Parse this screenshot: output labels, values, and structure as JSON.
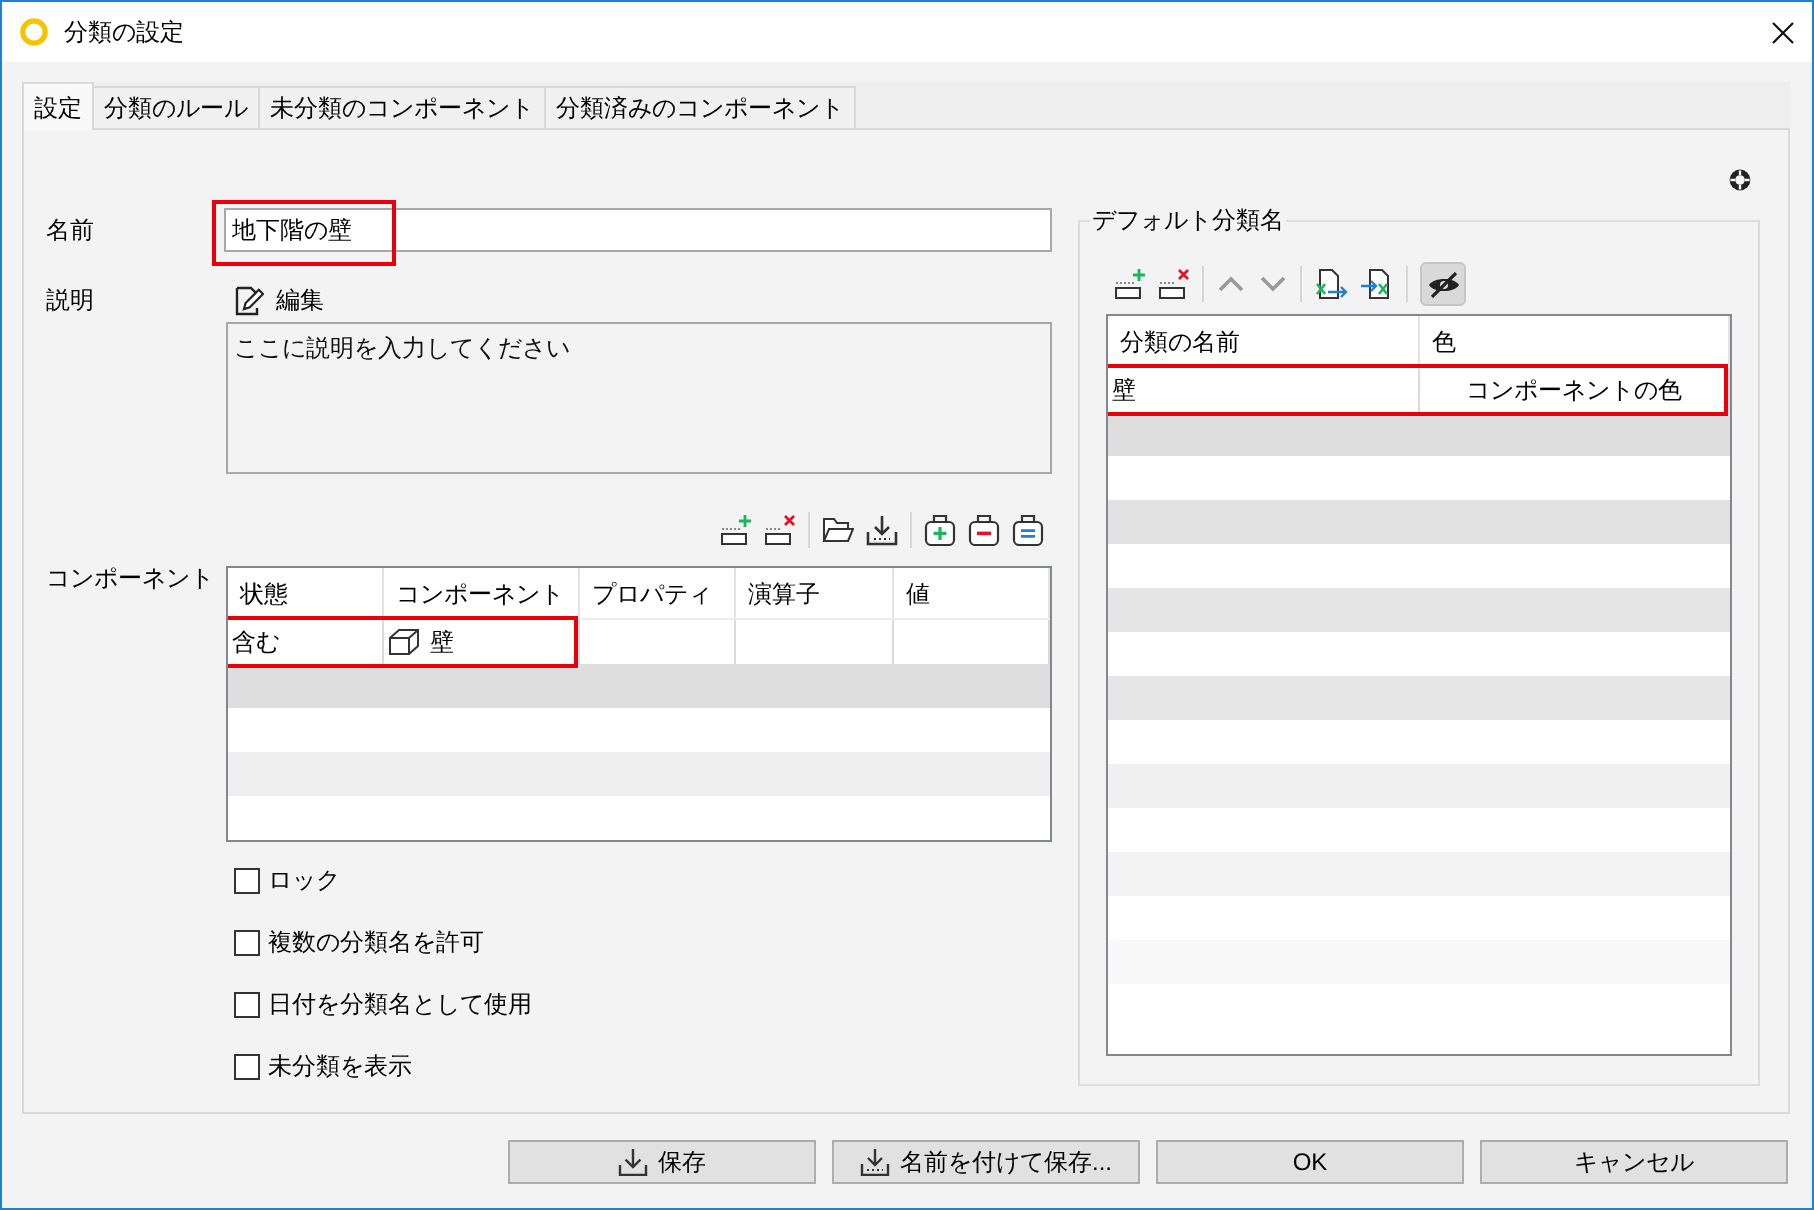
{
  "window": {
    "title": "分類の設定"
  },
  "tabs": [
    {
      "label": "設定",
      "selected": true
    },
    {
      "label": "分類のルール",
      "selected": false
    },
    {
      "label": "未分類のコンポーネント",
      "selected": false
    },
    {
      "label": "分類済みのコンポーネント",
      "selected": false
    }
  ],
  "name_field": {
    "label": "名前",
    "value": "地下階の壁",
    "highlighted": true
  },
  "description": {
    "label": "説明",
    "edit_button": "編集",
    "placeholder": "ここに説明を入力してください"
  },
  "components": {
    "label": "コンポーネント",
    "columns": [
      "状態",
      "コンポーネント",
      "プロパティ",
      "演算子",
      "値"
    ],
    "rows": [
      {
        "cells": [
          "含む",
          "壁"
        ],
        "highlighted": true
      }
    ]
  },
  "options": [
    {
      "label": "ロック",
      "checked": false
    },
    {
      "label": "複数の分類名を許可",
      "checked": false
    },
    {
      "label": "日付を分類名として使用",
      "checked": false
    },
    {
      "label": "未分類を表示",
      "checked": false
    }
  ],
  "default_names": {
    "title": "デフォルト分類名",
    "visibility_toggle": {
      "pressed": true
    },
    "columns": [
      "分類の名前",
      "色"
    ],
    "rows": [
      {
        "cells": [
          "壁",
          "コンポーネントの色"
        ],
        "highlighted": true
      }
    ]
  },
  "buttons": [
    {
      "kind": "save",
      "label": "保存"
    },
    {
      "kind": "save_as",
      "label": "名前を付けて保存..."
    },
    {
      "kind": "ok",
      "label": "OK"
    },
    {
      "kind": "cancel",
      "label": "キャンセル"
    }
  ]
}
